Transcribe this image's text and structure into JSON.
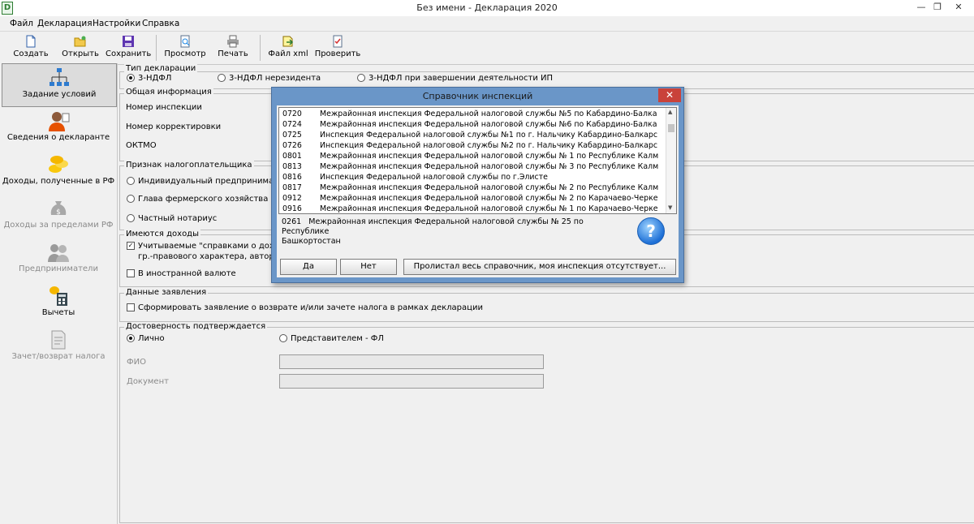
{
  "window": {
    "title": "Без имени - Декларация 2020",
    "app_icon_glyph": "D",
    "minimize_glyph": "—",
    "restore_glyph": "❐",
    "close_glyph": "✕"
  },
  "menu": [
    "Файл",
    "Декларация",
    "Настройки",
    "Справка"
  ],
  "toolbar": {
    "create": "Создать",
    "open": "Открыть",
    "save": "Сохранить",
    "preview": "Просмотр",
    "print": "Печать",
    "xml": "Файл xml",
    "check": "Проверить"
  },
  "sidebar": {
    "items": [
      {
        "label": "Задание условий",
        "icon": "network-tree-icon",
        "state": "active"
      },
      {
        "label": "Сведения о декларанте",
        "icon": "person-icon",
        "state": "normal"
      },
      {
        "label": "Доходы, полученные в РФ",
        "icon": "coins-icon",
        "state": "normal"
      },
      {
        "label": "Доходы за пределами РФ",
        "icon": "money-bag-icon",
        "state": "disabled"
      },
      {
        "label": "Предприниматели",
        "icon": "people-icon",
        "state": "disabled"
      },
      {
        "label": "Вычеты",
        "icon": "calculator-icon",
        "state": "normal"
      },
      {
        "label": "Зачет/возврат налога",
        "icon": "document-icon",
        "state": "disabled"
      }
    ]
  },
  "decl_type": {
    "legend": "Тип декларации",
    "options": [
      "3-НДФЛ",
      "3-НДФЛ нерезидента",
      "3-НДФЛ при завершении деятельности ИП"
    ],
    "selected": "3-НДФЛ"
  },
  "general": {
    "legend": "Общая информация",
    "inspection": "Номер инспекции",
    "correction": "Номер корректировки",
    "oktmo": "ОКТМО"
  },
  "taxpayer": {
    "legend": "Признак налогоплательщика",
    "options": [
      "Индивидуальный предпринимате",
      "Глава фермерского хозяйства",
      "Частный нотариус"
    ]
  },
  "income": {
    "legend": "Имеются доходы",
    "line1": "Учитываемые \"справками о доход",
    "line2": "гр.-правового характера, авторск",
    "line3": "В иностранной валюте",
    "line1_checked": true
  },
  "statement": {
    "legend": "Данные заявления",
    "checkbox": "Сформировать заявление о  возврате и/или зачете налога в рамках декларации"
  },
  "reliability": {
    "legend": "Достоверность подтверждается",
    "personally": "Лично",
    "representative": "Представителем - ФЛ",
    "fio_label": "ФИО",
    "doc_label": "Документ"
  },
  "dialog": {
    "title": "Справочник инспекций",
    "rows": [
      {
        "code": "0720",
        "name": "Межрайонная инспекция Федеральной налоговой службы №5 по Кабардино-Балка"
      },
      {
        "code": "0724",
        "name": "Межрайонная инспекция Федеральной налоговой службы №6 по Кабардино-Балка"
      },
      {
        "code": "0725",
        "name": "Инспекция Федеральной налоговой службы №1 по г. Нальчику Кабардино-Балкарс"
      },
      {
        "code": "0726",
        "name": "Инспекция Федеральной налоговой службы №2 по г. Нальчику Кабардино-Балкарс"
      },
      {
        "code": "0801",
        "name": "Межрайонная инспекция Федеральной налоговой службы № 1 по Республике Калм"
      },
      {
        "code": "0813",
        "name": "Межрайонная инспекция Федеральной налоговой службы № 3 по Республике Калм"
      },
      {
        "code": "0816",
        "name": "Инспекция Федеральной налоговой службы по г.Элисте"
      },
      {
        "code": "0817",
        "name": "Межрайонная инспекция Федеральной налоговой службы № 2 по Республике Калм"
      },
      {
        "code": "0912",
        "name": "Межрайонная инспекция Федеральной налоговой службы № 2 по Карачаево-Черке"
      },
      {
        "code": "0916",
        "name": "Межрайонная инспекция Федеральной налоговой службы № 1 по Карачаево-Черке"
      }
    ],
    "selected_code": "0261",
    "selected_line1": "Межрайонная инспекция Федеральной налоговой службы № 25 по Республике",
    "selected_line2": "Башкортостан",
    "help_glyph": "?",
    "yes": "Да",
    "no": "Нет",
    "missing": "Пролистал весь справочник, моя инспекция отсутствует..."
  }
}
